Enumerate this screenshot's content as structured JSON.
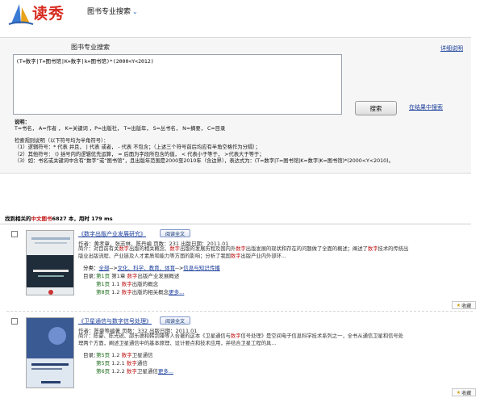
{
  "header": {
    "logo_text": "读秀",
    "nav_title": "图书专业搜索"
  },
  "search": {
    "panel_title": "图书专业搜索",
    "help_link": "详细说明",
    "query": "(T=数字|T=图书馆|K=数字|k=图书馆)*(2000<Y<2012)",
    "search_button": "搜索",
    "within_results_link": "在结果中搜索",
    "notes_title": "说明：",
    "field_codes": "T=书名， A=作者 ， K=关键词 ，P=出版社， T=出版年， S=丛书名， N=摘要， C=目录",
    "rules_title": "检索规则说明（以下符号均为半角符号）：",
    "rule1": "（1）逻辑符号：* 代表 并且， | 代表 或者， - 代表 不包含；（上述三个符号前后均应有半角空格作为分隔）；",
    "rule2": "（2）其他符号： () 括号内的逻辑优先运算， = 后面为字段所包含的值， < 代表小于等于， >代表大于等于；",
    "rule3": "（3）如：书名或关键词中含有“数字”或“图书馆”，且出版年范围是2000至2010年（含边界），表达式为：(T=数字|T=图书馆|K=数字|K=图书馆)*(2000<Y<2010)。"
  },
  "results": {
    "prefix": "找到相关的",
    "type": "中文图书",
    "count": "6827",
    "suffix": " 本，用时  179 ms"
  },
  "books": [
    {
      "title": "《数字出版产业发展研究》",
      "read_button": "阅读全文",
      "meta": "作者：黄孝章，张志林，陈丹编   页数：231   出版日期：2011.01",
      "desc_line1": [
        {
          "t": "简介：对目前有关"
        },
        {
          "t": "数字",
          "hl": true
        },
        {
          "t": "出版的相关概念、"
        },
        {
          "t": "数字",
          "hl": true
        },
        {
          "t": "出版的发展历程及国内外"
        },
        {
          "t": "数字",
          "hl": true
        },
        {
          "t": "出版发展的现状和存在的问题做了全面的概述；阐述了"
        },
        {
          "t": "数字",
          "hl": true
        },
        {
          "t": "技术的传统出"
        }
      ],
      "desc_line2": [
        {
          "t": "版业出版流程、产业链及人才素质和能力等方面的影响；分析了我国"
        },
        {
          "t": "数字",
          "hl": true
        },
        {
          "t": "出版产业内外部环..."
        }
      ],
      "category_label": "分类：",
      "categories": [
        "全部",
        "文化、科学、教育、体育",
        "信息与知识传播"
      ],
      "toc_label": "目录：",
      "toc": [
        {
          "page": "第1页",
          "pre": " 第1章 ",
          "hl": "数字",
          "post": "出版产业发展概述"
        },
        {
          "page": "第1页",
          "pre": " 1.1 ",
          "hl": "数字",
          "post": "出版的概念"
        },
        {
          "page": "第8页",
          "pre": " 1.2 ",
          "hl": "数字",
          "post": "出版的相关概念"
        }
      ],
      "more": "更多...",
      "fav": "收藏"
    },
    {
      "title": "《卫星通信与数字信号处理》",
      "read_button": "阅读全文",
      "meta": "作者：陈豪等编著   页数：332   出版日期：2011.01",
      "desc_line1": [
        {
          "t": "简介：陈豪、陈光锐、邵乐德和韩剑锋等人合著的这本《卫星通信与"
        },
        {
          "t": "数字",
          "hl": true
        },
        {
          "t": "信号处理》是空间电子信息科学技术系列之一，全书从通信卫星和信号处"
        }
      ],
      "desc_line2": [
        {
          "t": "理两个方面，阐述卫星通信中的基本原理、设计要点和技术应用，并结合卫星工程的具..."
        }
      ],
      "toc_label": "目录：",
      "toc": [
        {
          "page": "第5页",
          "pre": " 1.2 ",
          "hl": "数字",
          "post": "卫星通信"
        },
        {
          "page": "第5页",
          "pre": " 1.2.1 ",
          "hl": "数字",
          "post": "通信"
        },
        {
          "page": "第6页",
          "pre": " 1.2.2 ",
          "hl": "数字",
          "post": "卫星通信"
        }
      ],
      "more": "更多...",
      "fav": "收藏"
    }
  ]
}
